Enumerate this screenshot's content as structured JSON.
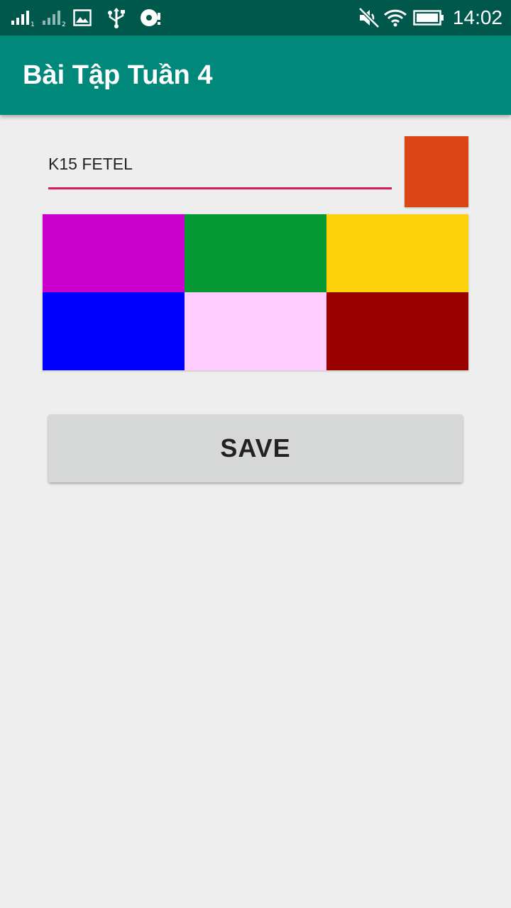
{
  "status_bar": {
    "time": "14:02",
    "icons": [
      "signal-sim1-icon",
      "signal-sim2-icon",
      "image-icon",
      "usb-icon",
      "disk-icon",
      "mute-icon",
      "wifi-icon",
      "battery-icon"
    ]
  },
  "app_bar": {
    "title": "Bài Tập Tuần 4"
  },
  "input": {
    "value": "K15 FETEL"
  },
  "preview": {
    "color": "#db4617"
  },
  "palette": {
    "colors": [
      "#cc00cc",
      "#069933",
      "#fdd20a",
      "#0000ff",
      "#ffccff",
      "#990000"
    ]
  },
  "actions": {
    "save_label": "SAVE"
  },
  "theme": {
    "status_bar": "#00574b",
    "app_bar": "#00897b",
    "accent": "#d81b60",
    "background": "#eeeeee"
  }
}
